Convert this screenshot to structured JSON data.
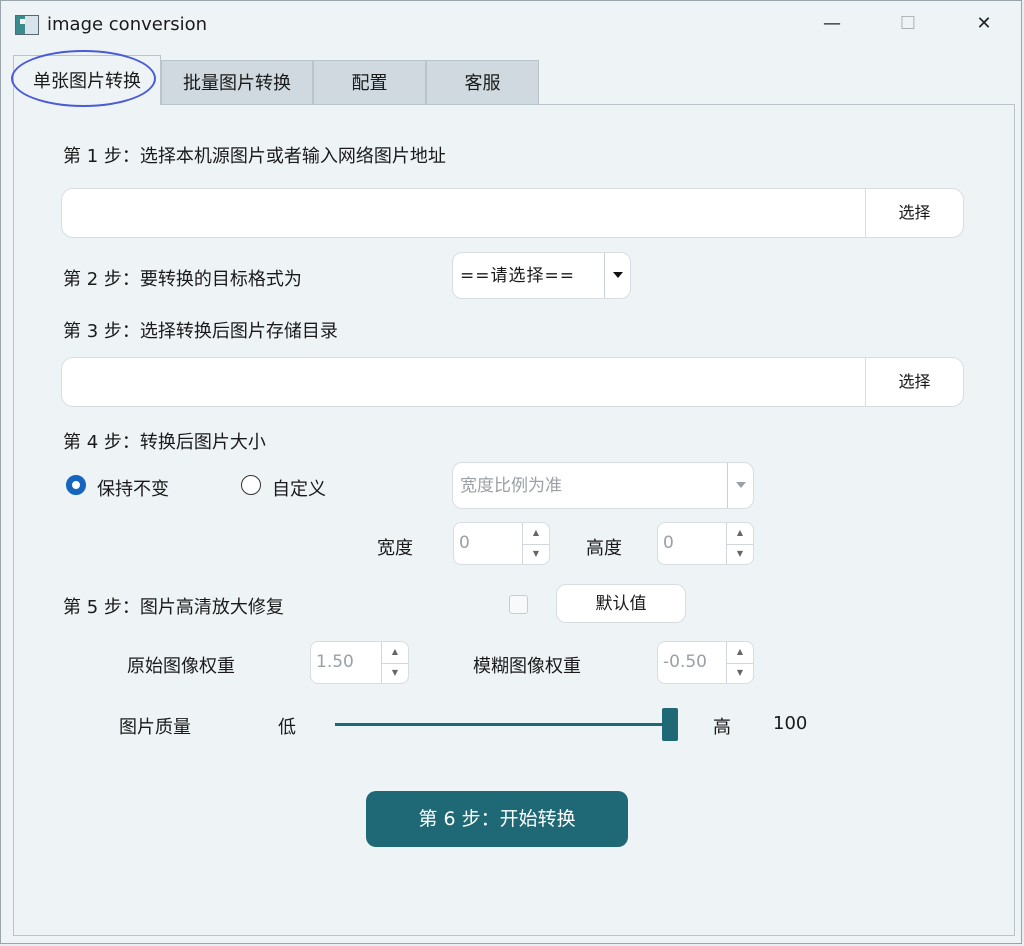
{
  "window": {
    "title": "image conversion",
    "minimize_glyph": "—",
    "maximize_glyph": "☐",
    "close_glyph": "✕",
    "icon": "app-icon"
  },
  "tabs": [
    {
      "label": "单张图片转换",
      "active": true
    },
    {
      "label": "批量图片转换",
      "active": false
    },
    {
      "label": "配置",
      "active": false
    },
    {
      "label": "客服",
      "active": false
    }
  ],
  "step1": {
    "label": "第 1 步：选择本机源图片或者输入网络图片地址",
    "input_value": "",
    "button": "选择"
  },
  "step2": {
    "label": "第 2 步：要转换的目标格式为",
    "format_selected": "==请选择=="
  },
  "step3": {
    "label": "第 3 步：选择转换后图片存储目录",
    "input_value": "",
    "button": "选择"
  },
  "step4": {
    "label": "第 4 步：转换后图片大小",
    "radio_keep": "保持不变",
    "radio_custom": "自定义",
    "selected_radio": "保持不变",
    "ratio_mode": "宽度比例为准",
    "width_label": "宽度",
    "width_value": "0",
    "height_label": "高度",
    "height_value": "0"
  },
  "step5": {
    "label": "第 5 步：图片高清放大修复",
    "enabled": false,
    "default_button": "默认值",
    "orig_weight_label": "原始图像权重",
    "orig_weight_value": "1.50",
    "blur_weight_label": "模糊图像权重",
    "blur_weight_value": "-0.50"
  },
  "quality": {
    "label": "图片质量",
    "low_label": "低",
    "high_label": "高",
    "value": "100"
  },
  "start_button": "第 6 步：开始转换",
  "colors": {
    "accent": "#1f6876",
    "radio_selected": "#1565c0",
    "tab_highlight": "#4a5bd6"
  }
}
